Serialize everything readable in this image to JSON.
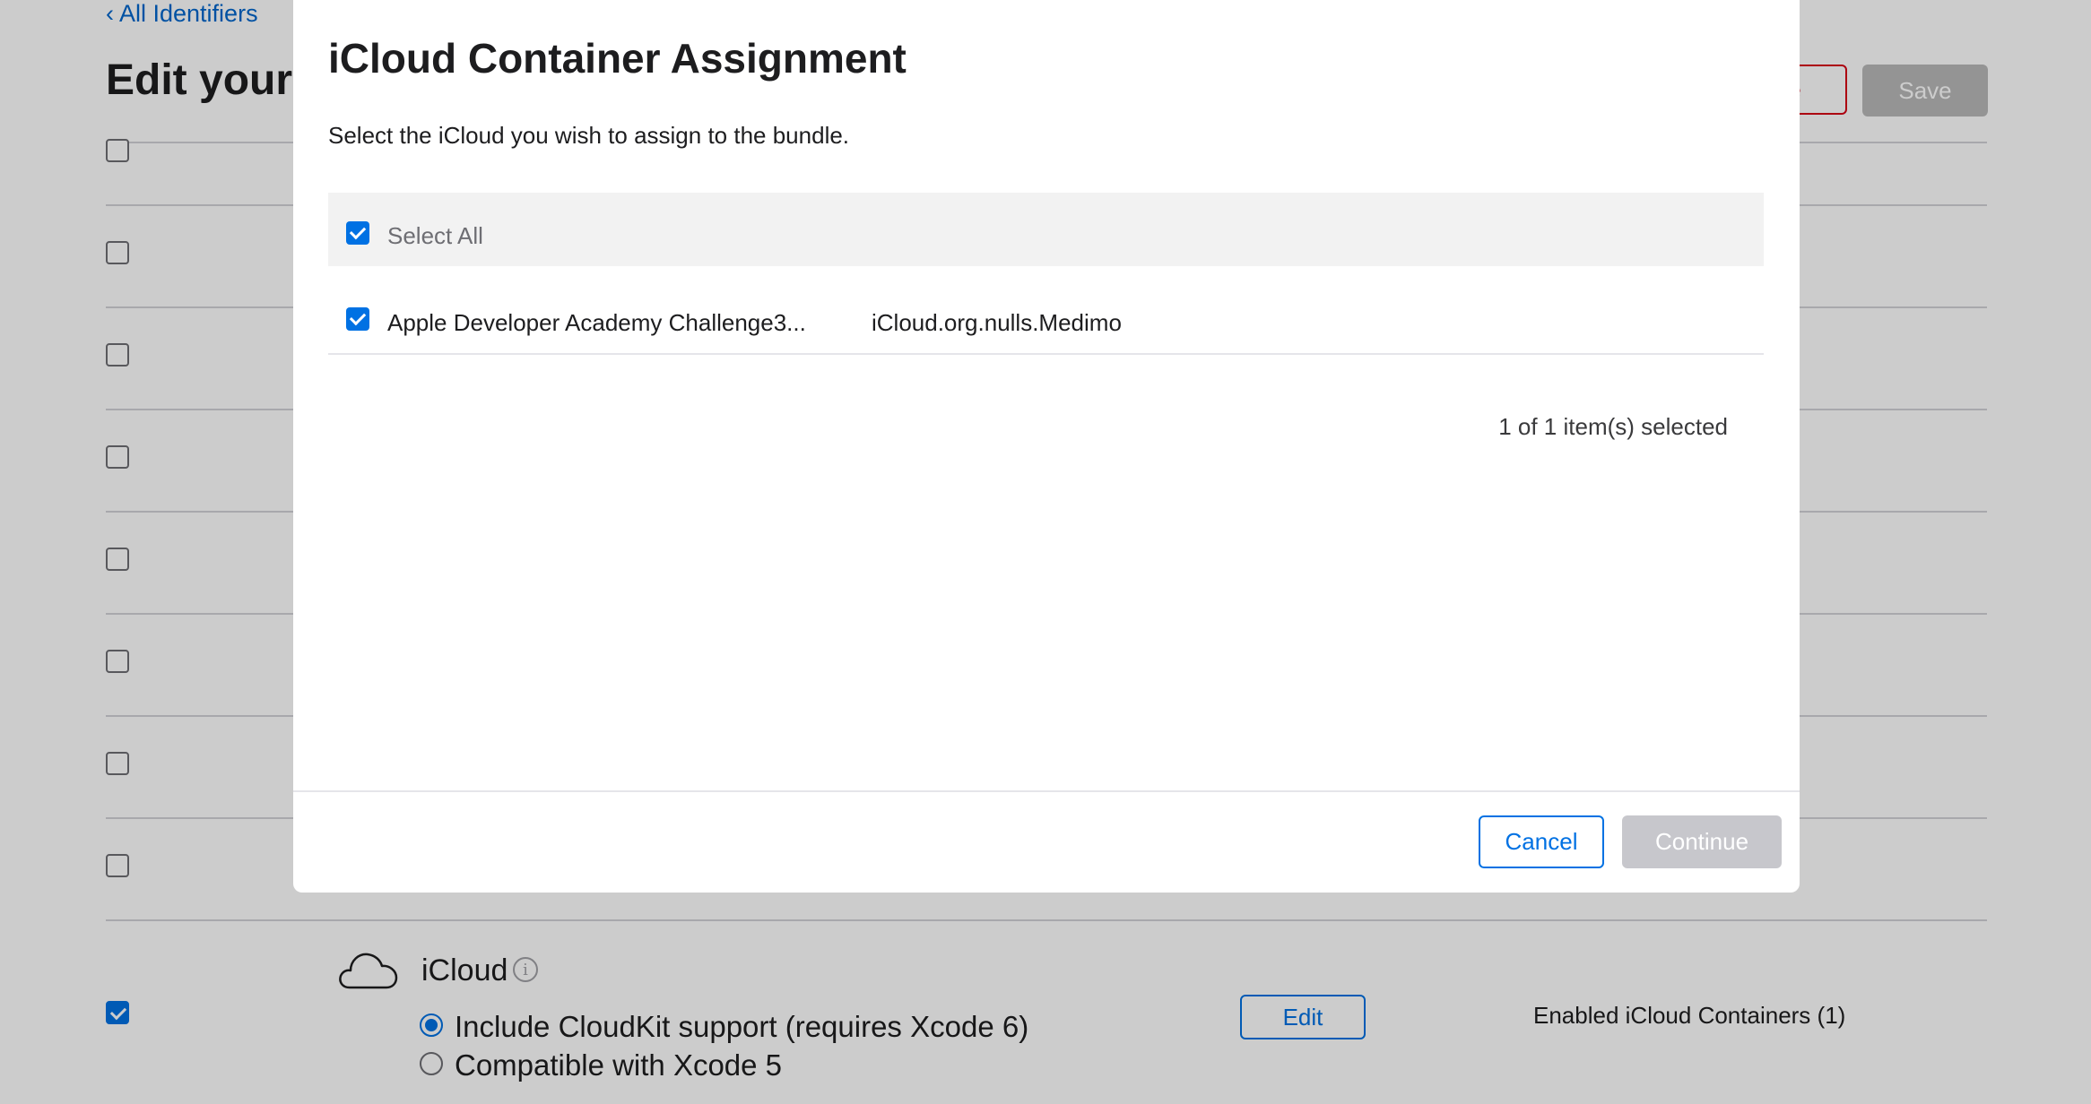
{
  "page": {
    "back_link": "‹ All Identifiers",
    "title": "Edit your",
    "remove_label": "ve",
    "save_label": "Save"
  },
  "capability": {
    "name": "iCloud",
    "icon": "cloud-icon",
    "info_icon": "i",
    "enabled": true,
    "options": [
      {
        "label": "Include CloudKit support (requires Xcode 6)",
        "selected": true
      },
      {
        "label": "Compatible with Xcode 5",
        "selected": false
      }
    ],
    "edit_label": "Edit",
    "status_text": "Enabled iCloud Containers (1)"
  },
  "modal": {
    "title": "iCloud Container Assignment",
    "description": "Select the iCloud you wish to assign to the bundle.",
    "select_all_label": "Select All",
    "selected_count": "1 of 1 item(s) selected",
    "items": [
      {
        "name": "Apple Developer Academy Challenge3...",
        "identifier": "iCloud.org.nulls.Medimo",
        "checked": true
      }
    ],
    "cancel_label": "Cancel",
    "continue_label": "Continue"
  },
  "colors": {
    "accent": "#0071e3",
    "danger": "#d70015",
    "disabled": "#c7c7cc"
  }
}
